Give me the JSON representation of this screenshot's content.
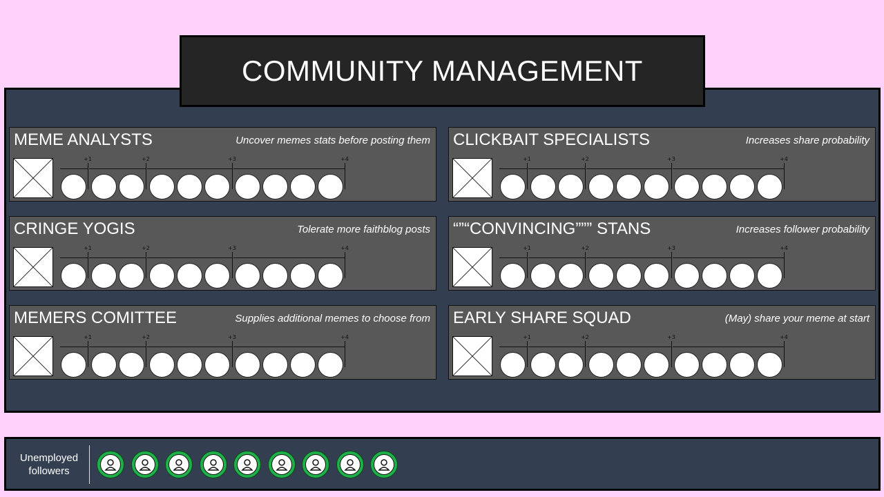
{
  "title": "COMMUNITY MANAGEMENT",
  "colors": {
    "background": "#ffd1fb",
    "panel": "#333f51",
    "banner": "#252525",
    "card": "#585858",
    "follower": "#1fb04a"
  },
  "track": {
    "tick_labels": [
      "+1",
      "+2",
      "+3",
      "+4"
    ],
    "circle_count": 10,
    "slot_icon": "empty-slot-icon"
  },
  "cards": [
    {
      "title": "MEME ANALYSTS",
      "description": "Uncover memes stats before posting them"
    },
    {
      "title": "CLICKBAIT SPECIALISTS",
      "description": "Increases share probability"
    },
    {
      "title": "CRINGE YOGIS",
      "description": "Tolerate more faithblog posts"
    },
    {
      "title": "“”“CONVINCING””” STANS",
      "description": "Increases follower probability"
    },
    {
      "title": "MEMERS COMITTEE",
      "description": "Supplies additional memes to choose from"
    },
    {
      "title": "EARLY SHARE SQUAD",
      "description": "(May) share your meme at start"
    }
  ],
  "unemployed": {
    "label_line1": "Unemployed",
    "label_line2": "followers",
    "count": 9,
    "icon": "follower-icon"
  }
}
